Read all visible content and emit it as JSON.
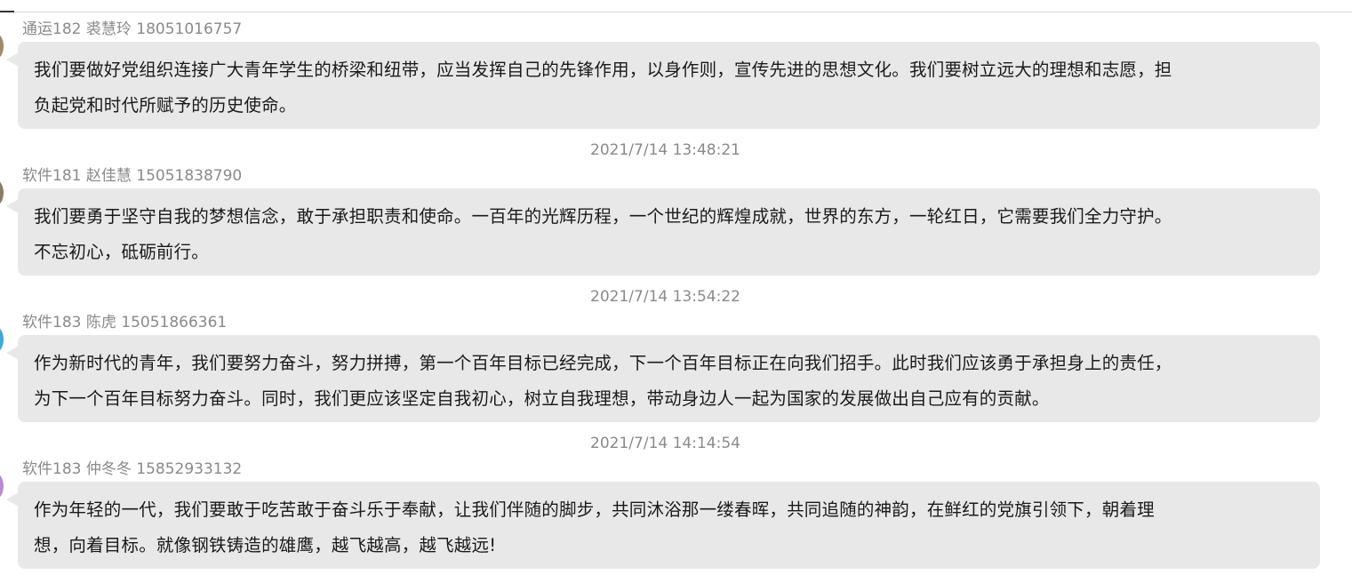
{
  "messages": [
    {
      "sender": "通运182 裘慧玲 18051016757",
      "lines": [
        "我们要做好党组织连接广大青年学生的桥梁和纽带，应当发挥自己的先锋作用，以身作则，宣传先进的思想文化。我们要树立远大的理想和志愿，担",
        "负起党和时代所赋予的历史使命。"
      ],
      "avatar_color": "#a08a6a"
    },
    {
      "timestamp": "2021/7/14 13:48:21",
      "sender": "软件181 赵佳慧 15051838790",
      "lines": [
        "我们要勇于坚守自我的梦想信念，敢于承担职责和使命。一百年的光辉历程，一个世纪的辉煌成就，世界的东方，一轮红日，它需要我们全力守护。",
        "不忘初心，砥砺前行。"
      ],
      "avatar_color": "#8c7a66"
    },
    {
      "timestamp": "2021/7/14 13:54:22",
      "sender": "软件183 陈虎 15051866361",
      "lines": [
        "作为新时代的青年，我们要努力奋斗，努力拼搏，第一个百年目标已经完成，下一个百年目标正在向我们招手。此时我们应该勇于承担身上的责任，",
        "为下一个百年目标努力奋斗。同时，我们更应该坚定自我初心，树立自我理想，带动身边人一起为国家的发展做出自己应有的贡献。"
      ],
      "avatar_color": "#3fa9d6"
    },
    {
      "timestamp": "2021/7/14 14:14:54",
      "sender": "软件183 仲冬冬 15852933132",
      "lines": [
        "作为年轻的一代，我们要敢于吃苦敢于奋斗乐于奉献，让我们伴随的脚步，共同沐浴那一缕春晖，共同追随的神韵，在鲜红的党旗引领下，朝着理",
        "想，向着目标。就像钢铁铸造的雄鹰，越飞越高，越飞越远!"
      ],
      "avatar_color": "#b98ad0"
    }
  ],
  "colors": {
    "bubble": "#e8e8e8",
    "meta_text": "#8a8a8a",
    "message_text": "#1a1a1a"
  }
}
